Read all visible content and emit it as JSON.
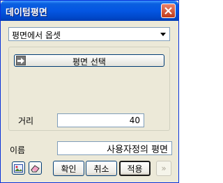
{
  "window": {
    "title": "데이텀평면"
  },
  "plane_type": {
    "selected": "평면에서 옵셋"
  },
  "select_plane_button": {
    "label": "평면 선택"
  },
  "distance": {
    "label": "거리",
    "value": "40"
  },
  "name": {
    "label": "이름",
    "value": "사용자정의 평면"
  },
  "buttons": {
    "ok": "확인",
    "cancel": "취소",
    "apply": "적용",
    "more": "»"
  },
  "colors": {
    "titlebar": "#0456e2",
    "close": "#c13a1a",
    "background": "#ece9d8"
  }
}
